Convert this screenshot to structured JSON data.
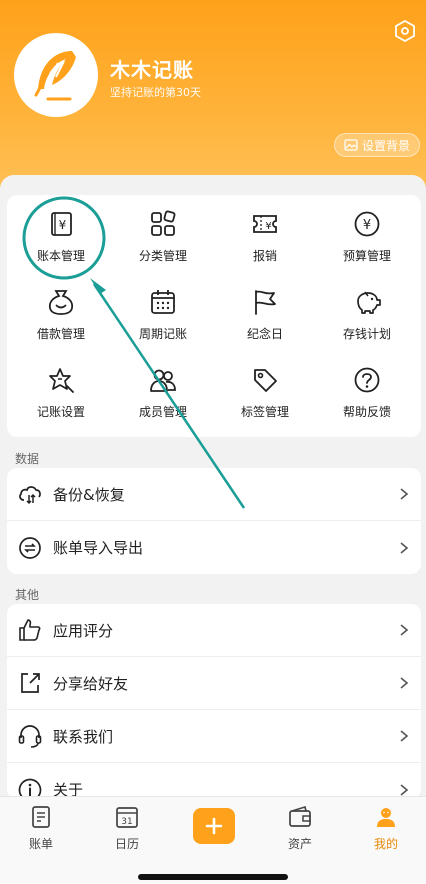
{
  "header": {
    "app_name": "木木记账",
    "slogan": "坚持记账的第30天",
    "bg_button_label": "设置背景"
  },
  "grid": [
    {
      "label": "账本管理",
      "icon": "ledger-icon"
    },
    {
      "label": "分类管理",
      "icon": "category-icon"
    },
    {
      "label": "报销",
      "icon": "reimburse-icon"
    },
    {
      "label": "预算管理",
      "icon": "budget-icon"
    },
    {
      "label": "借款管理",
      "icon": "loan-icon"
    },
    {
      "label": "周期记账",
      "icon": "calendar-icon"
    },
    {
      "label": "纪念日",
      "icon": "flag-icon"
    },
    {
      "label": "存钱计划",
      "icon": "piggy-bank-icon"
    },
    {
      "label": "记账设置",
      "icon": "settings-star-icon"
    },
    {
      "label": "成员管理",
      "icon": "members-icon"
    },
    {
      "label": "标签管理",
      "icon": "tag-icon"
    },
    {
      "label": "帮助反馈",
      "icon": "help-icon"
    }
  ],
  "sections": {
    "data_title": "数据",
    "data_items": [
      {
        "label": "备份&恢复",
        "icon": "cloud-sync-icon"
      },
      {
        "label": "账单导入导出",
        "icon": "import-export-icon"
      }
    ],
    "other_title": "其他",
    "other_items": [
      {
        "label": "应用评分",
        "icon": "thumbs-up-icon"
      },
      {
        "label": "分享给好友",
        "icon": "share-icon"
      },
      {
        "label": "联系我们",
        "icon": "headset-icon"
      },
      {
        "label": "关于",
        "icon": "info-icon"
      }
    ]
  },
  "tabbar": {
    "tabs": [
      {
        "label": "账单",
        "icon": "bill-icon"
      },
      {
        "label": "日历",
        "icon": "calendar-day-icon",
        "day": "31"
      },
      {
        "label": "资产",
        "icon": "wallet-icon"
      },
      {
        "label": "我的",
        "icon": "user-icon",
        "active": true
      }
    ]
  },
  "colors": {
    "accent": "#ffa11a",
    "annotation": "#1a9e96",
    "active_tab": "#e88a0a"
  }
}
